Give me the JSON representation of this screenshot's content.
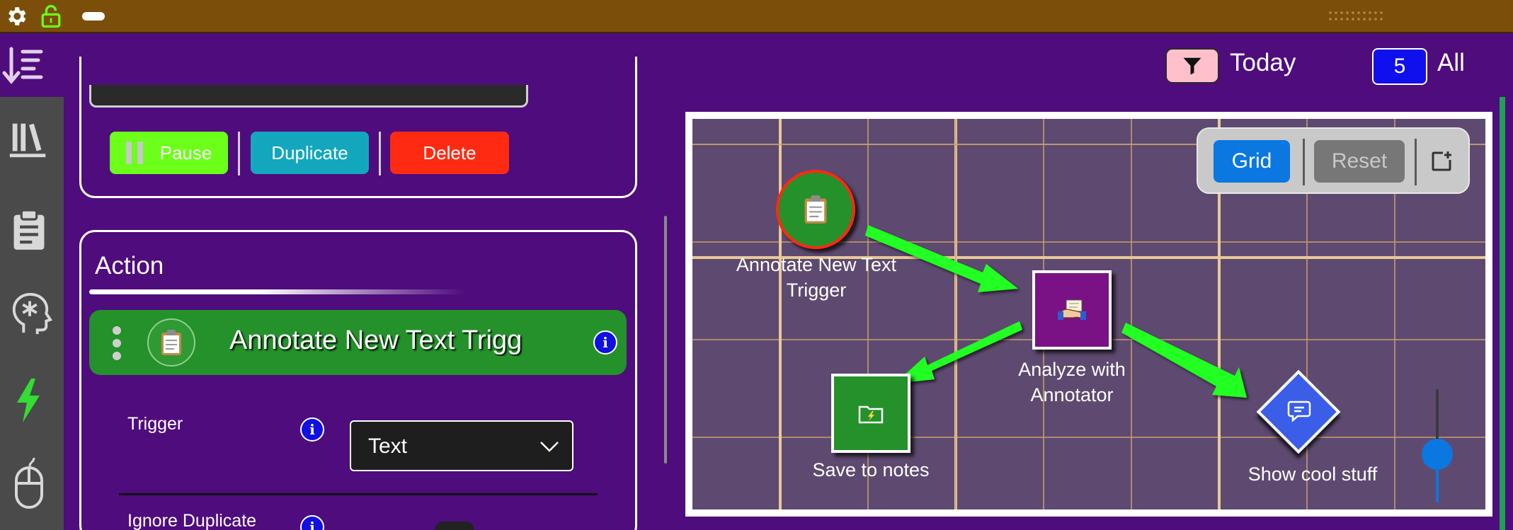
{
  "colors": {
    "background": "#4f0c7d",
    "topbar": "#7b4f0a",
    "pause": "#6bff1a",
    "duplicate": "#12a7bd",
    "delete": "#ff2a12",
    "action_bar": "#24912a",
    "canvas": "#5e4a70",
    "arrow": "#22ff22",
    "grid_button": "#0a78e0",
    "reset_button": "#777777"
  },
  "system_bar": {
    "icons": [
      "gear-icon",
      "unlocked-padlock-icon",
      "pill-indicator-icon",
      "drag-handle-dots-icon"
    ]
  },
  "header": {
    "sort_icon": "sort-descending-icon",
    "filter_icon": "funnel-icon",
    "filter_label": "Today",
    "count_badge": "5",
    "count_label": "All"
  },
  "left_rail": {
    "items": [
      {
        "icon": "library-books-icon"
      },
      {
        "icon": "clipboard-icon"
      },
      {
        "icon": "head-asterisk-icon"
      },
      {
        "icon": "lightning-bolt-icon",
        "active": true
      },
      {
        "icon": "mouse-icon"
      }
    ]
  },
  "controls": {
    "pause_label": "Pause",
    "duplicate_label": "Duplicate",
    "delete_label": "Delete"
  },
  "action_card": {
    "title": "Action",
    "item_title": "Annotate New Text Trigg",
    "fields": [
      {
        "label": "Trigger",
        "value": "Text"
      },
      {
        "label": "Ignore Duplicate"
      }
    ]
  },
  "canvas": {
    "toolbar": {
      "grid_label": "Grid",
      "reset_label": "Reset",
      "add_icon": "add-window-icon"
    },
    "nodes": [
      {
        "label": "Annotate New Text\nTrigger",
        "icon": "clipboard-emoji-icon",
        "shape": "circle"
      },
      {
        "label": "Analyze with\nAnnotator",
        "icon": "handshake-note-icon",
        "shape": "square"
      },
      {
        "label": "Save to notes",
        "icon": "folder-battery-icon",
        "shape": "square"
      },
      {
        "label": "Show cool stuff",
        "icon": "chat-bubble-icon",
        "shape": "diamond"
      }
    ]
  }
}
